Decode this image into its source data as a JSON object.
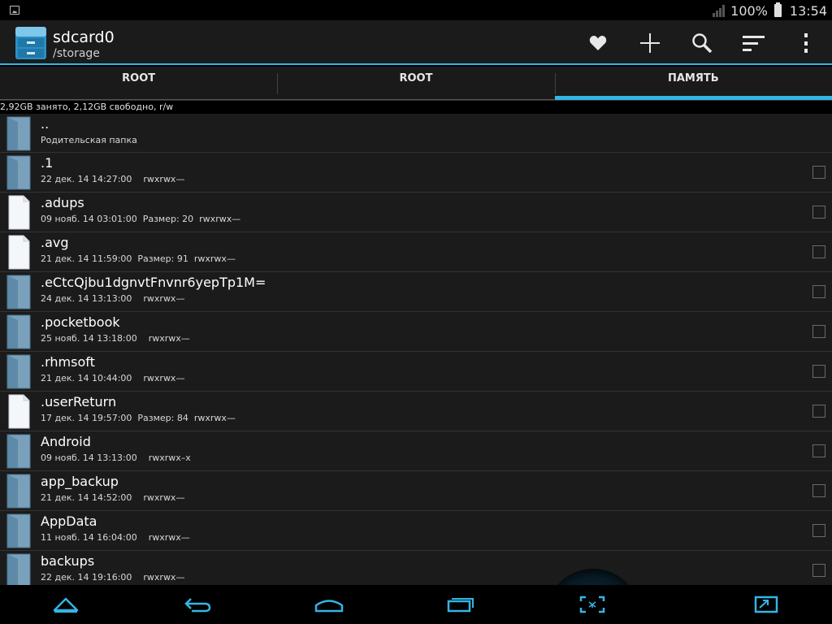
{
  "status_bar": {
    "battery": "100%",
    "time": "13:54"
  },
  "action_bar": {
    "title": "sdcard0",
    "subtitle": "/storage",
    "icons": [
      "favorites-icon",
      "add-icon",
      "search-icon",
      "sort-icon",
      "overflow-menu-icon"
    ]
  },
  "tabs": [
    {
      "label": "ROOT",
      "active": false
    },
    {
      "label": "ROOT",
      "active": false
    },
    {
      "label": "ПАМЯТЬ",
      "active": true
    }
  ],
  "storage_info": "2,92GB занято, 2,12GB свободно, r/w",
  "files": [
    {
      "type": "folder",
      "name": "..",
      "meta": "Родительская папка",
      "checkbox": false
    },
    {
      "type": "folder",
      "name": ".1",
      "meta": "22 дек. 14 14:27:00    rwxrwx—",
      "checkbox": true
    },
    {
      "type": "file",
      "name": ".adups",
      "meta": "09 нояб. 14 03:01:00  Размер: 20  rwxrwx—",
      "checkbox": true
    },
    {
      "type": "file",
      "name": ".avg",
      "meta": "21 дек. 14 11:59:00  Размер: 91  rwxrwx—",
      "checkbox": true
    },
    {
      "type": "folder",
      "name": ".eCtcQjbu1dgnvtFnvnr6yepTp1M=",
      "meta": "24 дек. 14 13:13:00    rwxrwx—",
      "checkbox": true
    },
    {
      "type": "folder",
      "name": ".pocketbook",
      "meta": "25 нояб. 14 13:18:00    rwxrwx—",
      "checkbox": true
    },
    {
      "type": "folder",
      "name": ".rhmsoft",
      "meta": "21 дек. 14 10:44:00    rwxrwx—",
      "checkbox": true
    },
    {
      "type": "file",
      "name": ".userReturn",
      "meta": "17 дек. 14 19:57:00  Размер: 84  rwxrwx—",
      "checkbox": true
    },
    {
      "type": "folder",
      "name": "Android",
      "meta": "09 нояб. 14 13:13:00    rwxrwx–x",
      "checkbox": true
    },
    {
      "type": "folder",
      "name": "app_backup",
      "meta": "21 дек. 14 14:52:00    rwxrwx—",
      "checkbox": true
    },
    {
      "type": "folder",
      "name": "AppData",
      "meta": "11 нояб. 14 16:04:00    rwxrwx—",
      "checkbox": true
    },
    {
      "type": "folder",
      "name": "backups",
      "meta": "22 дек. 14 19:16:00    rwxrwx—",
      "checkbox": true
    }
  ],
  "nav_bar": {
    "icons": [
      "hide-keyboard-icon",
      "back-icon",
      "home-icon",
      "recent-apps-icon",
      "screenshot-icon",
      "resize-icon"
    ]
  },
  "colors": {
    "accent": "#33b5e5",
    "background": "#1b1b1b",
    "folder": "#6f98b3"
  }
}
